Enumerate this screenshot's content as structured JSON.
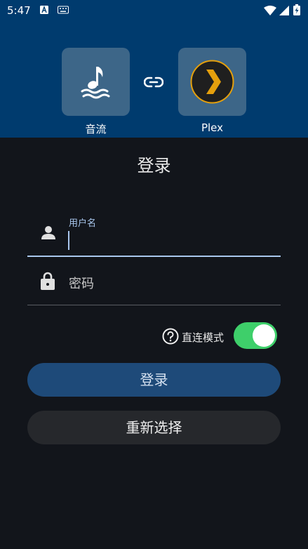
{
  "status_bar": {
    "time": "5:47"
  },
  "header": {
    "source_app": {
      "label": "音流",
      "icon": "music-note-wave-icon"
    },
    "link_icon": "link-icon",
    "target_app": {
      "label": "Plex",
      "icon": "plex-chevron-icon"
    }
  },
  "login": {
    "title": "登录",
    "username": {
      "label": "用户名",
      "value": "",
      "icon": "person-icon"
    },
    "password": {
      "placeholder": "密码",
      "icon": "lock-icon"
    },
    "direct_mode": {
      "label": "直连模式",
      "enabled": true,
      "icon": "help-circle-icon"
    },
    "login_button": "登录",
    "reselect_button": "重新选择"
  },
  "colors": {
    "header_bg": "#003b6e",
    "page_bg": "#12151b",
    "accent": "#a9c7ee",
    "switch_on": "#3ecf6a",
    "primary_button": "#1e4a79",
    "secondary_button": "#26282c",
    "plex_orange": "#e5a00d"
  }
}
